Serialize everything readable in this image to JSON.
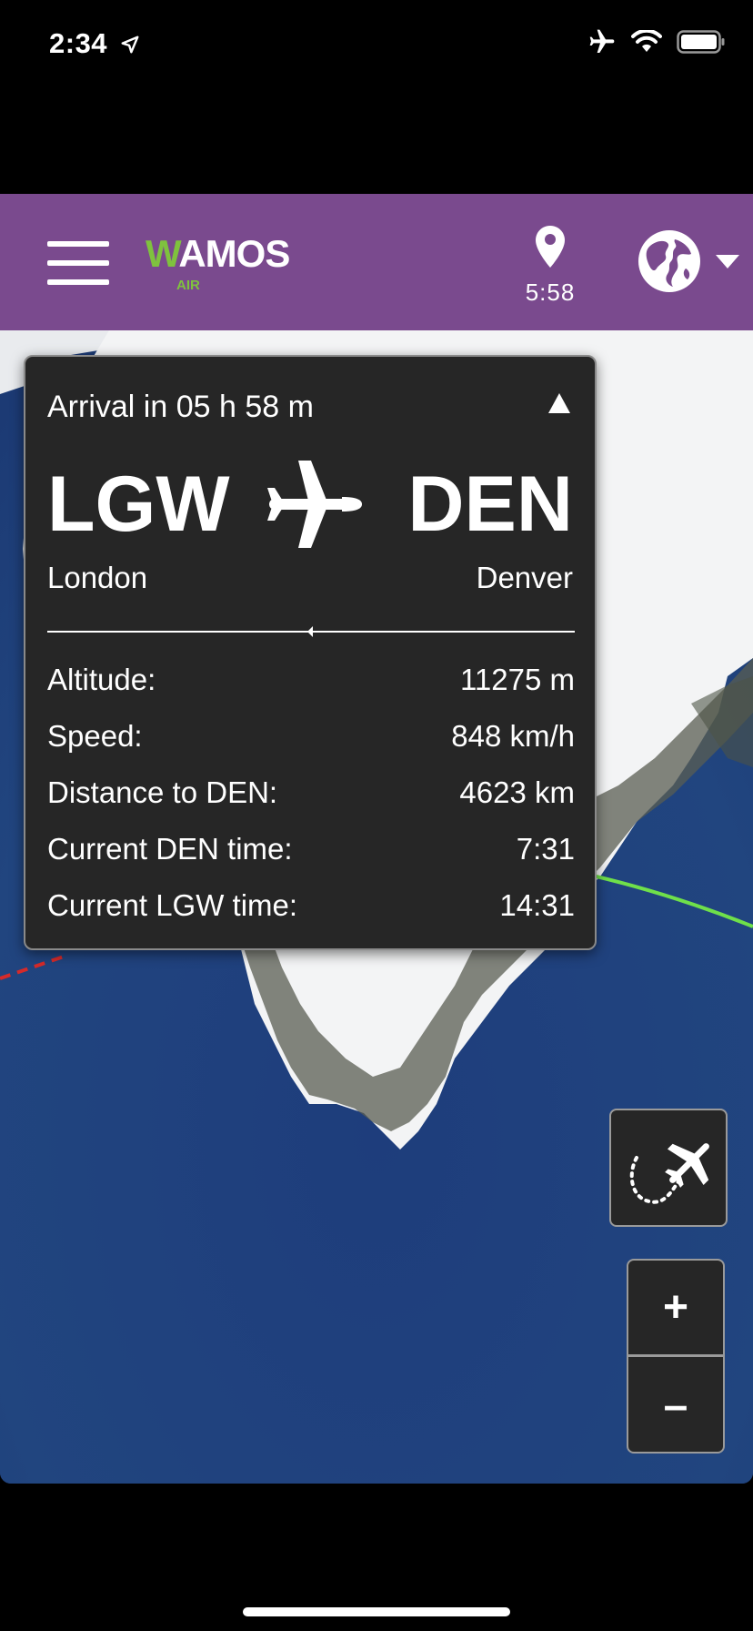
{
  "status_bar": {
    "time": "2:34",
    "icons": [
      "location-arrow-icon",
      "airplane-mode-icon",
      "wifi-icon",
      "battery-icon"
    ]
  },
  "header": {
    "logo_text": "WAMOS",
    "logo_subtext": "AIR",
    "location_time": "5:58",
    "colors": {
      "header_bg": "#7a4a8e",
      "logo_accent": "#7fc23e"
    }
  },
  "flight": {
    "arrival_text": "Arrival in 05 h 58 m",
    "origin_code": "LGW",
    "origin_city": "London",
    "destination_code": "DEN",
    "destination_city": "Denver",
    "stats": [
      {
        "label": "Altitude:",
        "value": "11275 m"
      },
      {
        "label": "Speed:",
        "value": "848 km/h"
      },
      {
        "label": "Distance to DEN:",
        "value": "4623 km"
      },
      {
        "label": "Current DEN time:",
        "value": "7:31"
      },
      {
        "label": "Current LGW time:",
        "value": "14:31"
      }
    ]
  },
  "map_controls": {
    "zoom_in": "+",
    "zoom_out": "–"
  }
}
